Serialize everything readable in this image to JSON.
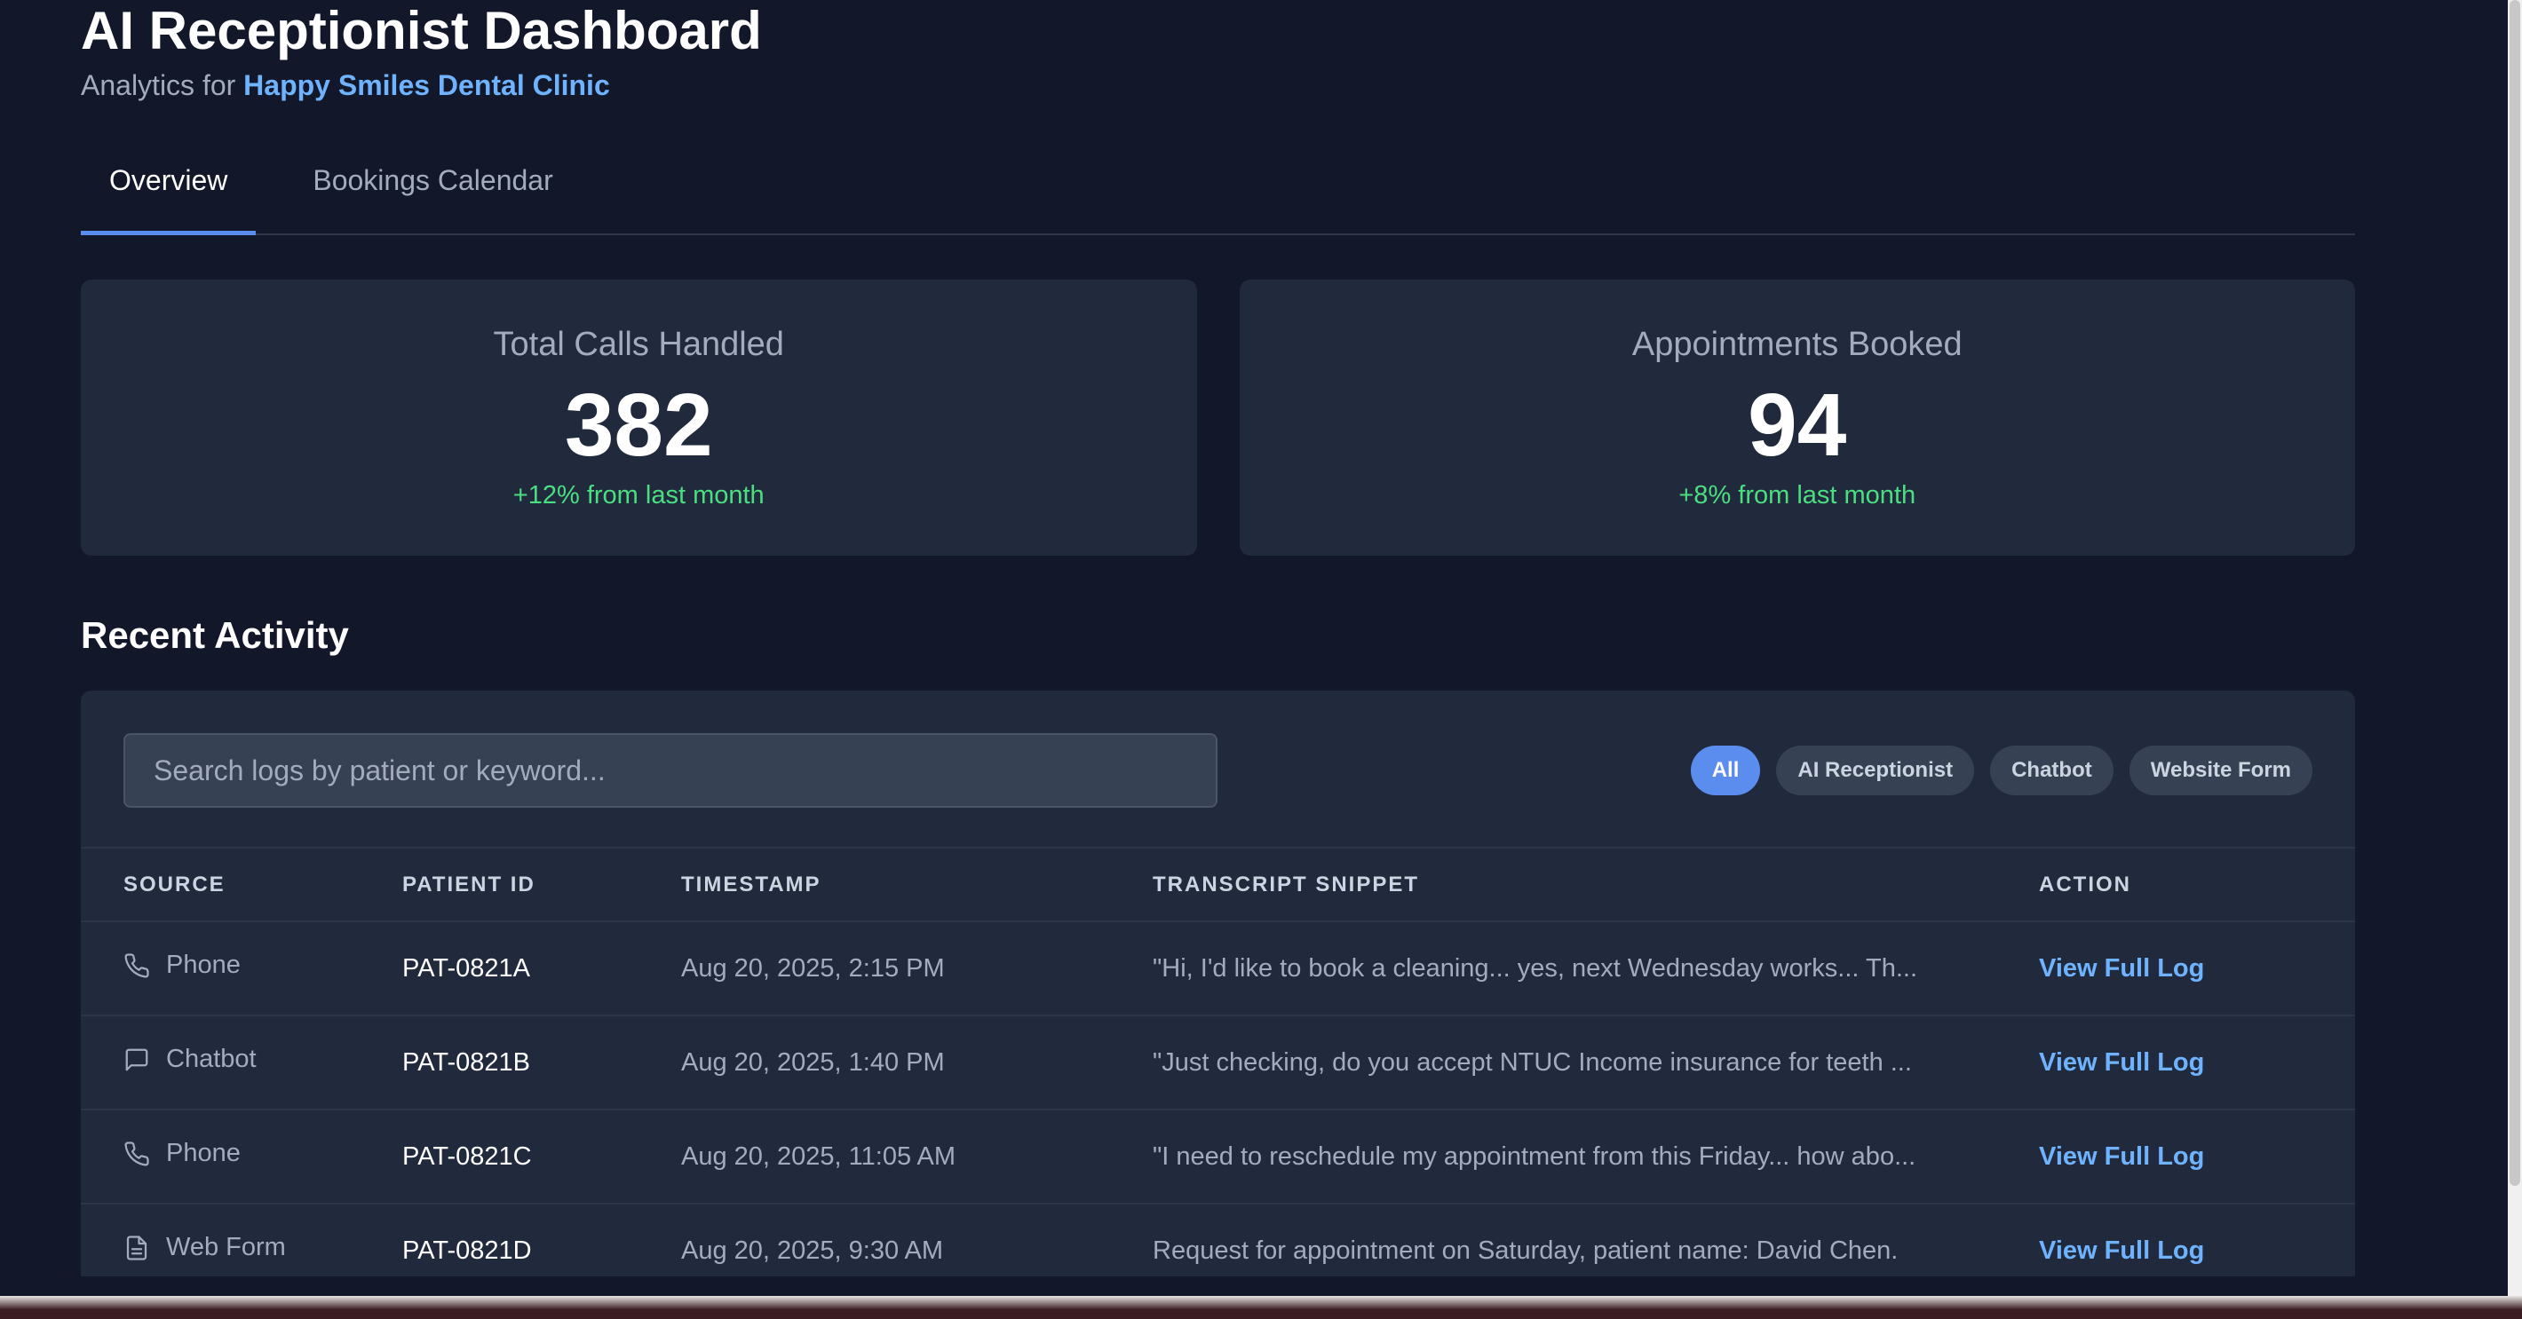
{
  "header": {
    "title": "AI Receptionist Dashboard",
    "subtitle_prefix": "Analytics for",
    "clinic_name": "Happy Smiles Dental Clinic"
  },
  "tabs": [
    {
      "label": "Overview",
      "active": true
    },
    {
      "label": "Bookings Calendar",
      "active": false
    }
  ],
  "stats": [
    {
      "label": "Total Calls Handled",
      "value": "382",
      "delta": "+12% from last month"
    },
    {
      "label": "Appointments Booked",
      "value": "94",
      "delta": "+8% from last month"
    }
  ],
  "activity": {
    "title": "Recent Activity",
    "search_placeholder": "Search logs by patient or keyword...",
    "filters": [
      {
        "label": "All",
        "active": true
      },
      {
        "label": "AI Receptionist",
        "active": false
      },
      {
        "label": "Chatbot",
        "active": false
      },
      {
        "label": "Website Form",
        "active": false
      }
    ],
    "columns": [
      "SOURCE",
      "PATIENT ID",
      "TIMESTAMP",
      "TRANSCRIPT SNIPPET",
      "ACTION"
    ],
    "rows": [
      {
        "source": "Phone",
        "icon": "phone-icon",
        "patient_id": "PAT-0821A",
        "timestamp": "Aug 20, 2025, 2:15 PM",
        "snippet": "\"Hi, I'd like to book a cleaning... yes, next Wednesday works... Th...",
        "action": "View Full Log"
      },
      {
        "source": "Chatbot",
        "icon": "chat-icon",
        "patient_id": "PAT-0821B",
        "timestamp": "Aug 20, 2025, 1:40 PM",
        "snippet": "\"Just checking, do you accept NTUC Income insurance for teeth ...",
        "action": "View Full Log"
      },
      {
        "source": "Phone",
        "icon": "phone-icon",
        "patient_id": "PAT-0821C",
        "timestamp": "Aug 20, 2025, 11:05 AM",
        "snippet": "\"I need to reschedule my appointment from this Friday... how abo...",
        "action": "View Full Log"
      },
      {
        "source": "Web Form",
        "icon": "document-icon",
        "patient_id": "PAT-0821D",
        "timestamp": "Aug 20, 2025, 9:30 AM",
        "snippet": "Request for appointment on Saturday, patient name: David Chen.",
        "action": "View Full Log"
      }
    ]
  },
  "colors": {
    "background": "#121829",
    "card": "#212a3d",
    "accent": "#5b8def",
    "link": "#6fb3ff",
    "positive": "#4ade80"
  }
}
